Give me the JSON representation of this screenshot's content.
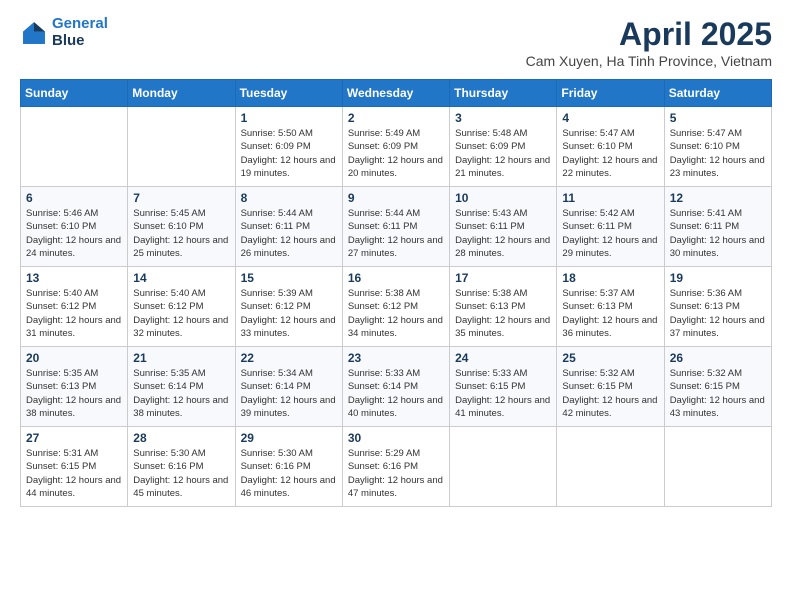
{
  "header": {
    "logo_line1": "General",
    "logo_line2": "Blue",
    "month_title": "April 2025",
    "location": "Cam Xuyen, Ha Tinh Province, Vietnam"
  },
  "days_of_week": [
    "Sunday",
    "Monday",
    "Tuesday",
    "Wednesday",
    "Thursday",
    "Friday",
    "Saturday"
  ],
  "weeks": [
    [
      {
        "day": "",
        "detail": ""
      },
      {
        "day": "",
        "detail": ""
      },
      {
        "day": "1",
        "detail": "Sunrise: 5:50 AM\nSunset: 6:09 PM\nDaylight: 12 hours and 19 minutes."
      },
      {
        "day": "2",
        "detail": "Sunrise: 5:49 AM\nSunset: 6:09 PM\nDaylight: 12 hours and 20 minutes."
      },
      {
        "day": "3",
        "detail": "Sunrise: 5:48 AM\nSunset: 6:09 PM\nDaylight: 12 hours and 21 minutes."
      },
      {
        "day": "4",
        "detail": "Sunrise: 5:47 AM\nSunset: 6:10 PM\nDaylight: 12 hours and 22 minutes."
      },
      {
        "day": "5",
        "detail": "Sunrise: 5:47 AM\nSunset: 6:10 PM\nDaylight: 12 hours and 23 minutes."
      }
    ],
    [
      {
        "day": "6",
        "detail": "Sunrise: 5:46 AM\nSunset: 6:10 PM\nDaylight: 12 hours and 24 minutes."
      },
      {
        "day": "7",
        "detail": "Sunrise: 5:45 AM\nSunset: 6:10 PM\nDaylight: 12 hours and 25 minutes."
      },
      {
        "day": "8",
        "detail": "Sunrise: 5:44 AM\nSunset: 6:11 PM\nDaylight: 12 hours and 26 minutes."
      },
      {
        "day": "9",
        "detail": "Sunrise: 5:44 AM\nSunset: 6:11 PM\nDaylight: 12 hours and 27 minutes."
      },
      {
        "day": "10",
        "detail": "Sunrise: 5:43 AM\nSunset: 6:11 PM\nDaylight: 12 hours and 28 minutes."
      },
      {
        "day": "11",
        "detail": "Sunrise: 5:42 AM\nSunset: 6:11 PM\nDaylight: 12 hours and 29 minutes."
      },
      {
        "day": "12",
        "detail": "Sunrise: 5:41 AM\nSunset: 6:11 PM\nDaylight: 12 hours and 30 minutes."
      }
    ],
    [
      {
        "day": "13",
        "detail": "Sunrise: 5:40 AM\nSunset: 6:12 PM\nDaylight: 12 hours and 31 minutes."
      },
      {
        "day": "14",
        "detail": "Sunrise: 5:40 AM\nSunset: 6:12 PM\nDaylight: 12 hours and 32 minutes."
      },
      {
        "day": "15",
        "detail": "Sunrise: 5:39 AM\nSunset: 6:12 PM\nDaylight: 12 hours and 33 minutes."
      },
      {
        "day": "16",
        "detail": "Sunrise: 5:38 AM\nSunset: 6:12 PM\nDaylight: 12 hours and 34 minutes."
      },
      {
        "day": "17",
        "detail": "Sunrise: 5:38 AM\nSunset: 6:13 PM\nDaylight: 12 hours and 35 minutes."
      },
      {
        "day": "18",
        "detail": "Sunrise: 5:37 AM\nSunset: 6:13 PM\nDaylight: 12 hours and 36 minutes."
      },
      {
        "day": "19",
        "detail": "Sunrise: 5:36 AM\nSunset: 6:13 PM\nDaylight: 12 hours and 37 minutes."
      }
    ],
    [
      {
        "day": "20",
        "detail": "Sunrise: 5:35 AM\nSunset: 6:13 PM\nDaylight: 12 hours and 38 minutes."
      },
      {
        "day": "21",
        "detail": "Sunrise: 5:35 AM\nSunset: 6:14 PM\nDaylight: 12 hours and 38 minutes."
      },
      {
        "day": "22",
        "detail": "Sunrise: 5:34 AM\nSunset: 6:14 PM\nDaylight: 12 hours and 39 minutes."
      },
      {
        "day": "23",
        "detail": "Sunrise: 5:33 AM\nSunset: 6:14 PM\nDaylight: 12 hours and 40 minutes."
      },
      {
        "day": "24",
        "detail": "Sunrise: 5:33 AM\nSunset: 6:15 PM\nDaylight: 12 hours and 41 minutes."
      },
      {
        "day": "25",
        "detail": "Sunrise: 5:32 AM\nSunset: 6:15 PM\nDaylight: 12 hours and 42 minutes."
      },
      {
        "day": "26",
        "detail": "Sunrise: 5:32 AM\nSunset: 6:15 PM\nDaylight: 12 hours and 43 minutes."
      }
    ],
    [
      {
        "day": "27",
        "detail": "Sunrise: 5:31 AM\nSunset: 6:15 PM\nDaylight: 12 hours and 44 minutes."
      },
      {
        "day": "28",
        "detail": "Sunrise: 5:30 AM\nSunset: 6:16 PM\nDaylight: 12 hours and 45 minutes."
      },
      {
        "day": "29",
        "detail": "Sunrise: 5:30 AM\nSunset: 6:16 PM\nDaylight: 12 hours and 46 minutes."
      },
      {
        "day": "30",
        "detail": "Sunrise: 5:29 AM\nSunset: 6:16 PM\nDaylight: 12 hours and 47 minutes."
      },
      {
        "day": "",
        "detail": ""
      },
      {
        "day": "",
        "detail": ""
      },
      {
        "day": "",
        "detail": ""
      }
    ]
  ]
}
